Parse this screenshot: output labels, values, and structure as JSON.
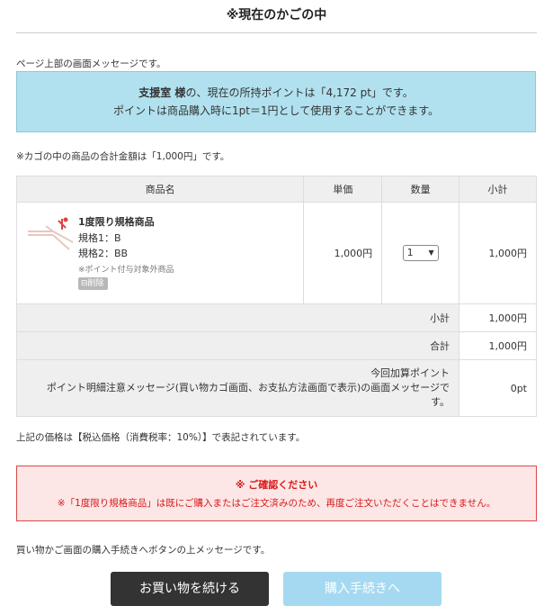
{
  "page": {
    "title": "※現在のかごの中"
  },
  "messages": {
    "top": "ページ上部の画面メッセージです。",
    "total_note": "※カゴの中の商品の合計金額は「1,000円」です。",
    "price_note": "上記の価格は【税込価格（消費税率：10%）】で表記されています。",
    "bottom": "買い物かご画面の購入手続きへボタンの上メッセージです。"
  },
  "points": {
    "user": "支援室 様",
    "line1_rest": "の、現在の所持ポイントは「4,172 pt」です。",
    "line2": "ポイントは商品購入時に1pt＝1円として使用することができます。"
  },
  "table": {
    "headers": {
      "product": "商品名",
      "unit_price": "単価",
      "quantity": "数量",
      "subtotal": "小計"
    },
    "item": {
      "name": "1度限り規格商品",
      "spec1": "規格1：B",
      "spec2": "規格2：BB",
      "note": "※ポイント付与対象外商品",
      "delete_label": "削除",
      "unit_price": "1,000円",
      "quantity": "1",
      "subtotal": "1,000円"
    },
    "summary": {
      "subtotal_label": "小計",
      "subtotal_value": "1,000円",
      "total_label": "合計",
      "total_value": "1,000円",
      "points_label_line1": "今回加算ポイント",
      "points_label_line2": "ポイント明細注意メッセージ(買い物カゴ画面、お支払方法画面で表示)の画面メッセージで",
      "points_label_line3": "す。",
      "points_value": "0pt"
    }
  },
  "warning": {
    "title": "※ ご確認ください",
    "body": "※「1度限り規格商品」は既にご購入またはご注文済みのため、再度ご注文いただくことはできません。"
  },
  "buttons": {
    "continue": "お買い物を続ける",
    "checkout": "購入手続きへ"
  },
  "colors": {
    "point_box_bg": "#b1e1ef",
    "warning_text": "#d61a1a",
    "checkout_button": "#a5d9f1",
    "continue_button": "#333333"
  }
}
